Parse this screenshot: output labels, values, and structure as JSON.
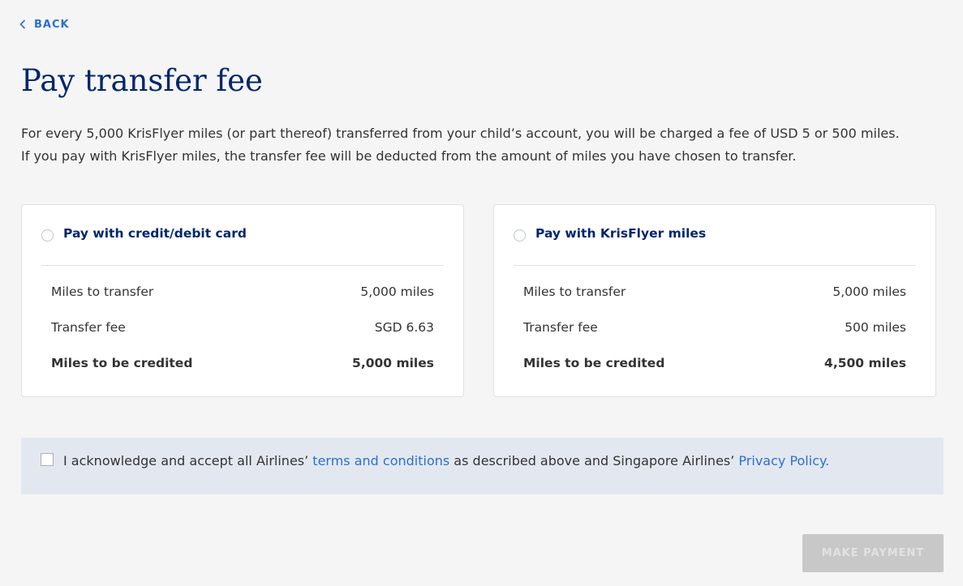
{
  "nav": {
    "back_label": "BACK"
  },
  "page": {
    "title": "Pay transfer fee",
    "intro_line1": "For every 5,000 KrisFlyer miles (or part thereof) transferred from your child’s account, you will be charged a fee of USD 5 or 500 miles.",
    "intro_line2": "If you pay with KrisFlyer miles, the transfer fee will be deducted from the amount of miles you have chosen to transfer."
  },
  "options": [
    {
      "title": "Pay with credit/debit card",
      "selected": false,
      "rows": [
        {
          "label": "Miles to transfer",
          "value": "5,000 miles"
        },
        {
          "label": "Transfer fee",
          "value": "SGD 6.63"
        },
        {
          "label": "Miles to be credited",
          "value": "5,000 miles"
        }
      ]
    },
    {
      "title": "Pay with KrisFlyer miles",
      "selected": false,
      "rows": [
        {
          "label": "Miles to transfer",
          "value": "5,000 miles"
        },
        {
          "label": "Transfer fee",
          "value": "500 miles"
        },
        {
          "label": "Miles to be credited",
          "value": "4,500 miles"
        }
      ]
    }
  ],
  "acknowledgement": {
    "checked": false,
    "text_before": "I acknowledge and accept all Airlines’ ",
    "terms_link": "terms and conditions",
    "text_middle": " as described above and Singapore Airlines’ ",
    "privacy_link": "Privacy Policy."
  },
  "actions": {
    "make_payment_label": "MAKE PAYMENT",
    "make_payment_enabled": false
  },
  "colors": {
    "background": "#f5f5f5",
    "navy": "#00266b",
    "link_blue": "#2b6fd6",
    "ack_panel": "#e3e8f0",
    "disabled_button": "#c8c8c8"
  }
}
